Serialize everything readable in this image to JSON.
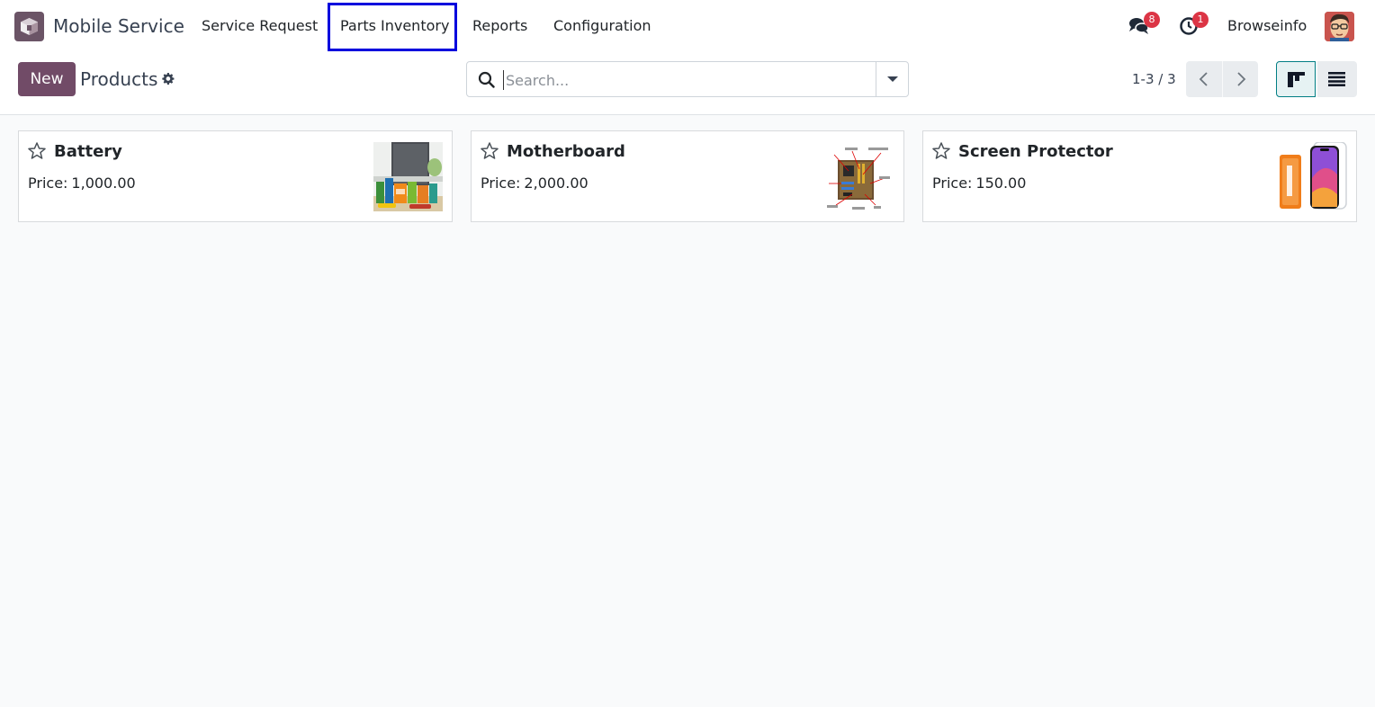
{
  "navbar": {
    "app_name": "Mobile Service",
    "menu": [
      "Service Request",
      "Parts Inventory",
      "Reports",
      "Configuration"
    ],
    "messages_count": "8",
    "activities_count": "1",
    "user_name": "Browseinfo"
  },
  "control_panel": {
    "new_label": "New",
    "title": "Products",
    "search_placeholder": "Search...",
    "pager": "1-3 / 3"
  },
  "products": [
    {
      "name": "Battery",
      "price_label": "Price:",
      "price": "1,000.00",
      "image": "battery-image"
    },
    {
      "name": "Motherboard",
      "price_label": "Price:",
      "price": "2,000.00",
      "image": "motherboard-image"
    },
    {
      "name": "Screen Protector",
      "price_label": "Price:",
      "price": "150.00",
      "image": "screen-protector-image"
    }
  ],
  "colors": {
    "brand": "#714b67",
    "highlight": "#0000dd",
    "badge": "#dc3545",
    "active_view": "#017e84"
  }
}
